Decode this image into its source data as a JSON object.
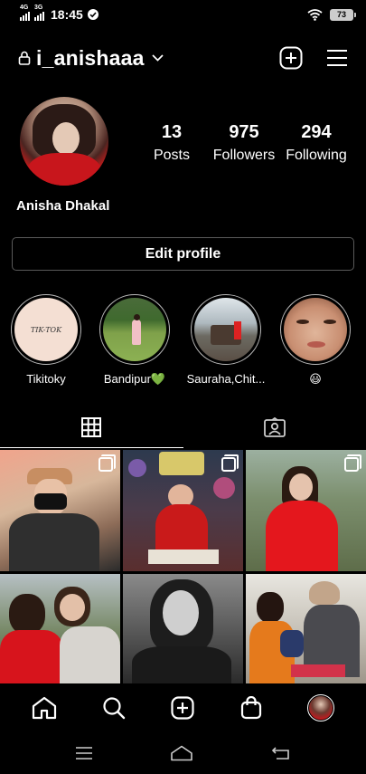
{
  "status_bar": {
    "sim1_label": "4G",
    "sim2_label": "3G",
    "time": "18:45",
    "battery": "73"
  },
  "header": {
    "username": "i_anishaaa"
  },
  "profile": {
    "stats": [
      {
        "count": "13",
        "label": "Posts"
      },
      {
        "count": "975",
        "label": "Followers"
      },
      {
        "count": "294",
        "label": "Following"
      }
    ],
    "display_name": "Anisha Dhakal",
    "edit_label": "Edit profile"
  },
  "highlights": [
    {
      "label": "Tikitoky",
      "cover_text": "TIK-TOK"
    },
    {
      "label": "Bandipur💚"
    },
    {
      "label": "Sauraha,Chit..."
    },
    {
      "label": "😃"
    }
  ],
  "colors": {
    "background": "#000000",
    "text": "#ffffff",
    "border": "#5a5a5a",
    "highlight_ring": "#bbbbbb"
  },
  "icons": {
    "lock": "lock-icon",
    "chevron": "chevron-down-icon",
    "new_post": "plus-square-icon",
    "menu": "hamburger-icon",
    "grid": "grid-icon",
    "tagged": "person-tag-icon",
    "home": "home-icon",
    "search": "search-icon",
    "create": "plus-square-icon",
    "shop": "shopping-bag-icon"
  }
}
